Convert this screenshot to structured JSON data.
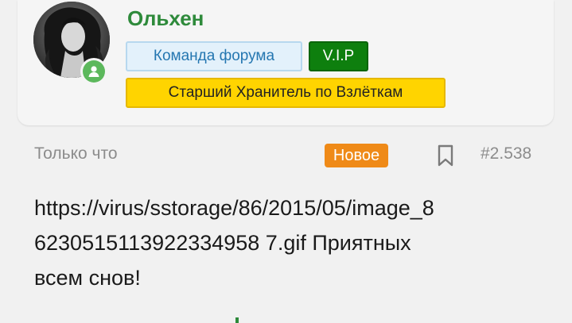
{
  "author": {
    "username": "Ольхен",
    "avatar_icon": "avatar-photo",
    "online_icon": "user-online-icon",
    "badges": {
      "team": "Команда форума",
      "vip": "V.I.P",
      "rank": "Старший Хранитель по Взлёткам"
    }
  },
  "post_meta": {
    "time": "Только что",
    "new_label": "Новое",
    "bookmark_icon": "bookmark-icon",
    "post_number": "#2.538"
  },
  "post": {
    "line1": "https://virus/sstorage/86/2015/05/image_8",
    "line2": "6230515113922334958 7.gif Приятных",
    "line3": "всем снов!"
  },
  "colors": {
    "username": "#2e8a3b",
    "vip_bg": "#0e7f0e",
    "rank_bg": "#ffd400",
    "team_bg": "#e3f1fb",
    "new_bg": "#ef8a18",
    "online": "#5cb85c"
  }
}
